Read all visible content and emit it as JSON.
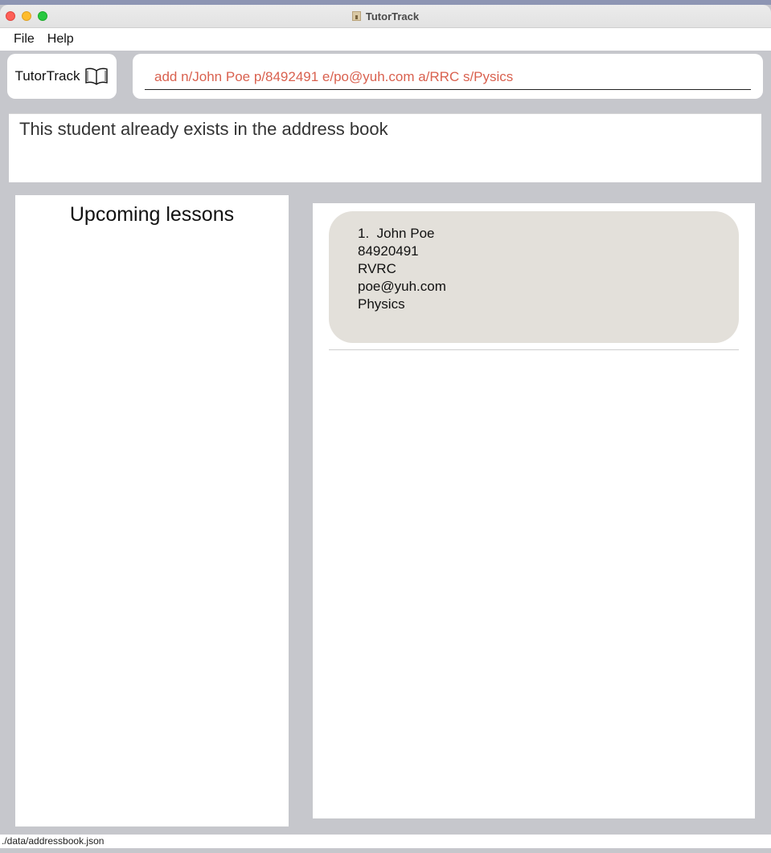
{
  "window": {
    "title": "TutorTrack"
  },
  "menu": {
    "items": [
      "File",
      "Help"
    ]
  },
  "brand": {
    "label": "TutorTrack",
    "icon": "book-icon"
  },
  "command": {
    "value": "add n/John Poe p/8492491 e/po@yuh.com a/RRC s/Pysics"
  },
  "result": {
    "message": "This student already exists in the address book"
  },
  "lessons": {
    "title": "Upcoming lessons"
  },
  "persons": [
    {
      "index": "1.",
      "name": "John Poe",
      "phone": "84920491",
      "address": "RVRC",
      "email": "poe@yuh.com",
      "subject": "Physics"
    }
  ],
  "status": {
    "path": "./data/addressbook.json"
  },
  "colors": {
    "command_text": "#d9614f",
    "card_background": "#e3e0da",
    "app_background": "#c6c7cc"
  }
}
